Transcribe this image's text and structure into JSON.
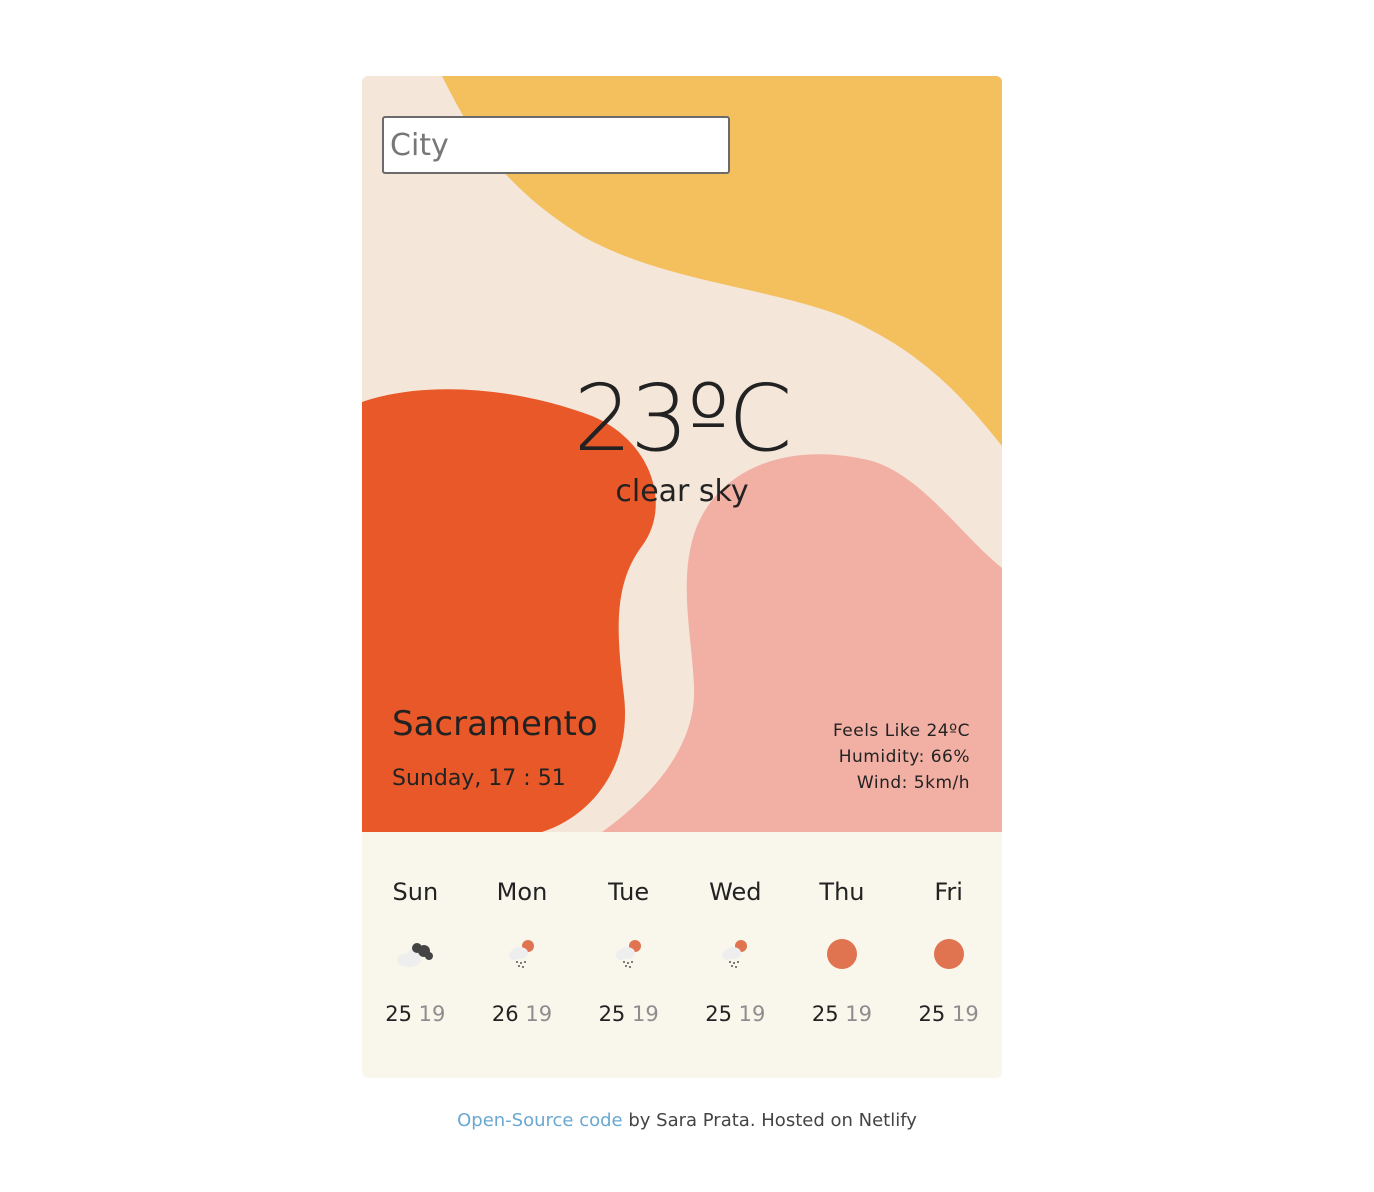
{
  "search": {
    "placeholder": "City",
    "value": ""
  },
  "current": {
    "temperature": "23ºC",
    "description": "clear sky",
    "city": "Sacramento",
    "datetime": "Sunday, 17 : 51",
    "feels_like": "Feels Like 24ºC",
    "humidity": "Humidity: 66%",
    "wind": "Wind: 5km/h"
  },
  "forecast": [
    {
      "day": "Sun",
      "icon": "broken-clouds-icon",
      "max": "25",
      "min": "19"
    },
    {
      "day": "Mon",
      "icon": "rain-icon",
      "max": "26",
      "min": "19"
    },
    {
      "day": "Tue",
      "icon": "rain-icon",
      "max": "25",
      "min": "19"
    },
    {
      "day": "Wed",
      "icon": "rain-icon",
      "max": "25",
      "min": "19"
    },
    {
      "day": "Thu",
      "icon": "sun-icon",
      "max": "25",
      "min": "19"
    },
    {
      "day": "Fri",
      "icon": "sun-icon",
      "max": "25",
      "min": "19"
    }
  ],
  "footer": {
    "link_text": "Open-Source code",
    "rest_text": " by Sara Prata. Hosted on Netlify"
  },
  "colors": {
    "hero_bg": "#f4e6d9",
    "yellow_blob": "#f4bf5d",
    "orange_blob": "#e95828",
    "pink_blob": "#f2afa4",
    "forecast_bg": "#f9f6ec",
    "sun": "#e07350",
    "link": "#6aa8d2"
  }
}
